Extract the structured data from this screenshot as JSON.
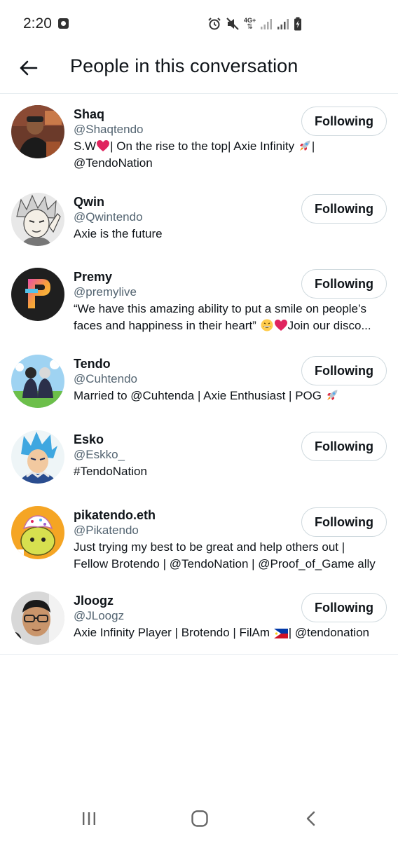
{
  "status_bar": {
    "time": "2:20",
    "network_label": "4G+"
  },
  "header": {
    "title": "People in this conversation"
  },
  "colors": {
    "heart": "#e0245e",
    "muted_text": "#536471",
    "divider": "#e6ecf0"
  },
  "people": [
    {
      "name": "Shaq",
      "handle": "@Shaqtendo",
      "bio": [
        "S.W",
        "| On the rise to the top| Axie Infinity ",
        "|",
        "@TendoNation"
      ],
      "button": "Following"
    },
    {
      "name": "Qwin",
      "handle": "@Qwintendo",
      "bio": [
        "Axie is the future"
      ],
      "button": "Following"
    },
    {
      "name": "Premy",
      "handle": "@premylive",
      "bio": [
        "“We have this amazing ability to put a smile on people’s",
        "faces and happiness in their heart” ",
        "Join our disco..."
      ],
      "button": "Following"
    },
    {
      "name": "Tendo",
      "handle": "@Cuhtendo",
      "bio": [
        "Married to @Cuhtenda | Axie Enthusiast | POG "
      ],
      "button": "Following"
    },
    {
      "name": "Esko",
      "handle": "@Eskko_",
      "bio": [
        "#TendoNation"
      ],
      "button": "Following"
    },
    {
      "name": "pikatendo.eth",
      "handle": "@Pikatendo",
      "bio": [
        "Just trying my best to be great and help others out |",
        "Fellow Brotendo | @TendoNation | @Proof_of_Game ally"
      ],
      "button": "Following"
    },
    {
      "name": "Jloogz",
      "handle": "@JLoogz",
      "bio": [
        "Axie Infinity Player | Brotendo | FilAm ",
        "| @tendonation"
      ],
      "button": "Following"
    }
  ]
}
